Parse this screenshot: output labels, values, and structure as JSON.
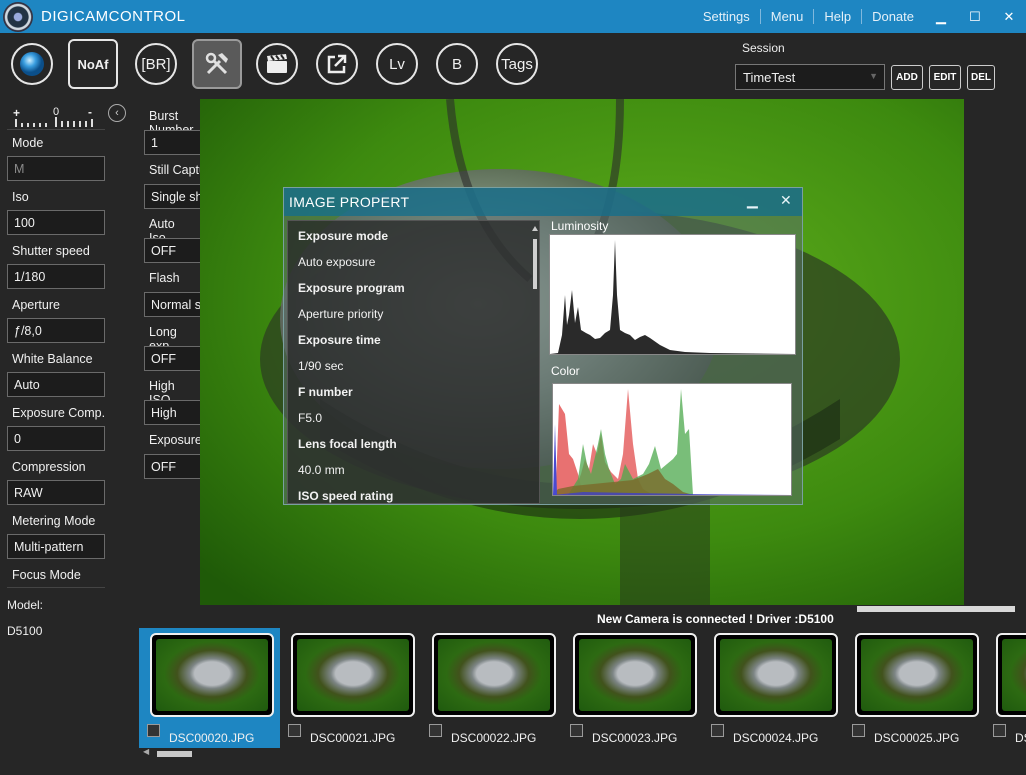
{
  "app": {
    "title": "DIGICAMCONTROL"
  },
  "menu": {
    "settings": "Settings",
    "menu": "Menu",
    "help": "Help",
    "donate": "Donate"
  },
  "window": {
    "minimize": "▁",
    "maximize": "☐",
    "close": "✕"
  },
  "toolbar": {
    "noaf": "NoAf",
    "br": "[BR]",
    "lv": "Lv",
    "b": "B",
    "tags": "Tags"
  },
  "session": {
    "label": "Session",
    "value": "TimeTest",
    "add": "ADD",
    "edit": "EDIT",
    "del": "DEL"
  },
  "scale": {
    "plus": "+",
    "zero": "0",
    "minus": "-"
  },
  "left_fields": [
    {
      "label": "Mode",
      "value": "M"
    },
    {
      "label": "Iso",
      "value": "100"
    },
    {
      "label": "Shutter speed",
      "value": "1/180"
    },
    {
      "label": "Aperture",
      "value": "ƒ/8,0"
    },
    {
      "label": "White Balance",
      "value": "Auto"
    },
    {
      "label": "Exposure Comp.",
      "value": "0"
    },
    {
      "label": "Compression",
      "value": "RAW"
    },
    {
      "label": "Metering Mode",
      "value": "Multi-pattern"
    },
    {
      "label": "Focus Mode",
      "value": ""
    }
  ],
  "model": {
    "label": "Model:",
    "value": "D5100"
  },
  "mid_fields": [
    {
      "label": "Burst Number",
      "value": "1"
    },
    {
      "label": "Still Capture Moc",
      "value": "Single shot (si"
    },
    {
      "label": "Auto Iso",
      "value": "OFF"
    },
    {
      "label": "Flash",
      "value": "Normal synch"
    },
    {
      "label": "Long exp. NR",
      "value": "OFF"
    },
    {
      "label": "High ISO NR",
      "value": "High"
    },
    {
      "label": "Exposure delay m",
      "value": "OFF"
    }
  ],
  "dialog": {
    "title": "IMAGE PROPERT",
    "properties": [
      {
        "text": "Exposure mode",
        "bold": true
      },
      {
        "text": "Auto exposure",
        "bold": false
      },
      {
        "text": "Exposure program",
        "bold": true
      },
      {
        "text": "Aperture priority",
        "bold": false
      },
      {
        "text": "Exposure time",
        "bold": true
      },
      {
        "text": "1/90 sec",
        "bold": false
      },
      {
        "text": "F number",
        "bold": true
      },
      {
        "text": "F5.0",
        "bold": false
      },
      {
        "text": "Lens focal length",
        "bold": true
      },
      {
        "text": "40.0 mm",
        "bold": false
      },
      {
        "text": "ISO speed rating",
        "bold": true
      }
    ],
    "luminosity_label": "Luminosity",
    "color_label": "Color"
  },
  "status": "New Camera is connected ! Driver :D5100",
  "thumbnails": [
    {
      "name": "DSC00020.JPG",
      "selected": true
    },
    {
      "name": "DSC00021.JPG",
      "selected": false
    },
    {
      "name": "DSC00022.JPG",
      "selected": false
    },
    {
      "name": "DSC00023.JPG",
      "selected": false
    },
    {
      "name": "DSC00024.JPG",
      "selected": false
    },
    {
      "name": "DSC00025.JPG",
      "selected": false
    },
    {
      "name": "DSC",
      "selected": false
    }
  ]
}
